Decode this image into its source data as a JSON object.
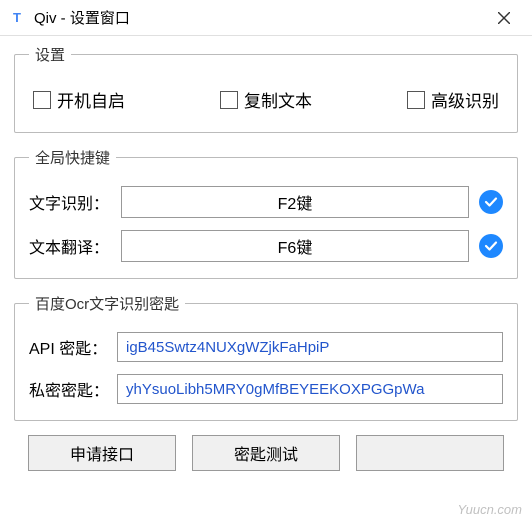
{
  "titlebar": {
    "title": "Qiv - 设置窗口"
  },
  "settings": {
    "legend": "设置",
    "autostart_label": "开机自启",
    "copytext_label": "复制文本",
    "advrecog_label": "高级识别"
  },
  "hotkeys": {
    "legend": "全局快捷键",
    "ocr_label": "文字识别：",
    "ocr_key": "F2键",
    "translate_label": "文本翻译：",
    "translate_key": "F6键"
  },
  "baidu": {
    "legend": "百度Ocr文字识别密匙",
    "api_label": "API 密匙：",
    "api_value": "igB45Swtz4NUXgWZjkFaHpiP",
    "secret_label": "私密密匙：",
    "secret_value": "yhYsuoLibh5MRY0gMfBEYEEKOXPGGpWa"
  },
  "buttons": {
    "apply": "申请接口",
    "test": "密匙测试",
    "third": ""
  },
  "watermark": "Yuucn.com"
}
